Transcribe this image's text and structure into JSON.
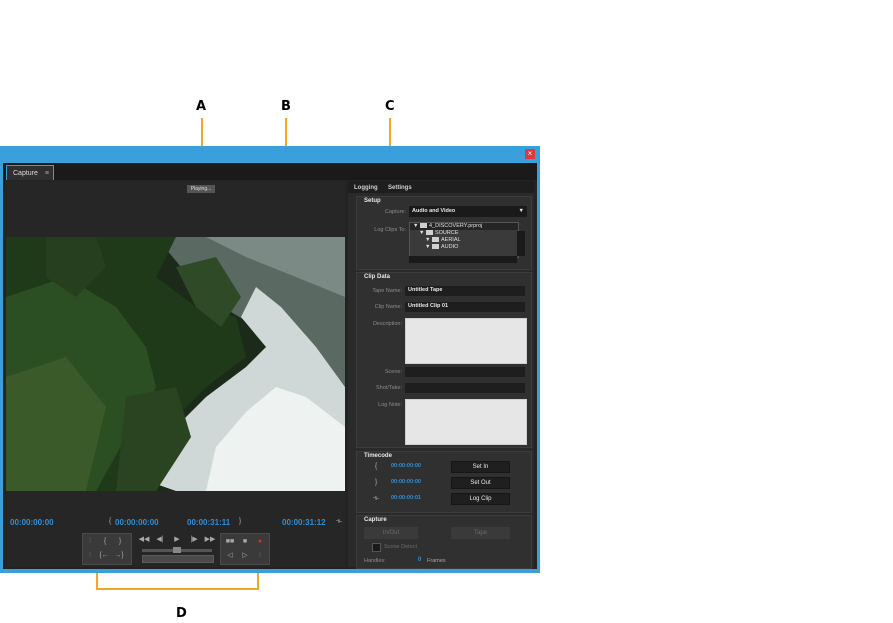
{
  "callouts": {
    "a": "A",
    "b": "B",
    "c": "C",
    "d": "D"
  },
  "window": {
    "close": "×",
    "tab_label": "Capture",
    "tab_menu": "≡"
  },
  "video": {
    "status": "Playing..."
  },
  "timecodes": {
    "current": "00:00:00:00",
    "in_point": "00:00:00:00",
    "out_point": "00:00:31:11",
    "duration": "00:00:31:12"
  },
  "transport": {
    "left_icons": [
      "{",
      "}",
      "{←",
      "→}"
    ],
    "playback": [
      "◀◀",
      "◀|",
      "▶",
      "|▶",
      "▶▶"
    ],
    "right_icons": [
      "■■",
      "■",
      "●",
      "◁",
      "▷"
    ]
  },
  "panel": {
    "tabs": [
      "Logging",
      "Settings"
    ],
    "setup": {
      "title": "Setup",
      "capture_label": "Capture:",
      "capture_value": "Audio and Video",
      "log_clips_label": "Log Clips To:",
      "tree": [
        "4_DISCOVERY.prproj",
        "SOURCE",
        "AERIAL",
        "AUDIO"
      ]
    },
    "clip_data": {
      "title": "Clip Data",
      "tape_name_label": "Tape Name:",
      "tape_name_value": "Untitled Tape",
      "clip_name_label": "Clip Name:",
      "clip_name_value": "Untitled Clip 01",
      "description_label": "Description:",
      "scene_label": "Scene:",
      "shot_take_label": "Shot/Take:",
      "log_note_label": "Log Note:"
    },
    "timecode": {
      "title": "Timecode",
      "set_in_tc": "00:00:00:00",
      "set_out_tc": "00:00:00:00",
      "log_clip_tc": "00:00:00:01",
      "set_in": "Set In",
      "set_out": "Set Out",
      "log_clip": "Log Clip"
    },
    "capture": {
      "title": "Capture",
      "in_out": "In/Out",
      "tape": "Tape",
      "scene_detect": "Scene Detect",
      "handles_label": "Handles:",
      "handles_value": "0",
      "handles_unit": "Frames"
    }
  }
}
